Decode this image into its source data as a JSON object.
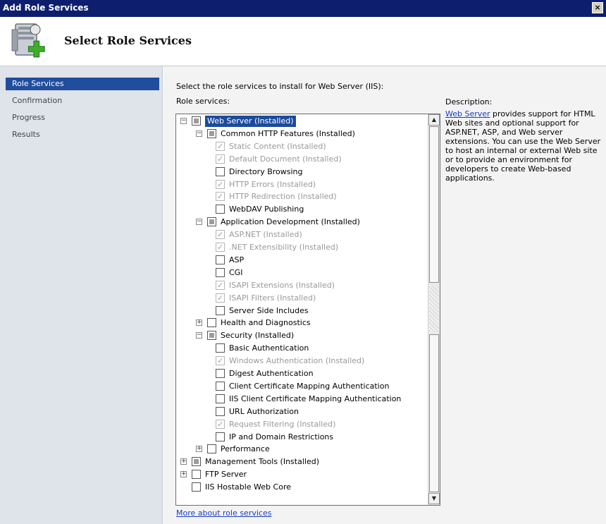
{
  "window": {
    "title": "Add Role Services",
    "close_label": "×"
  },
  "header": {
    "title": "Select Role Services",
    "icon": "server-add-icon"
  },
  "nav": {
    "items": [
      {
        "label": "Role Services",
        "active": true
      },
      {
        "label": "Confirmation",
        "active": false
      },
      {
        "label": "Progress",
        "active": false
      },
      {
        "label": "Results",
        "active": false
      }
    ]
  },
  "main": {
    "intro": "Select the role services to install for Web Server (IIS):",
    "role_services_label": "Role services:",
    "more_link": "More about role services"
  },
  "description": {
    "title": "Description:",
    "link": "Web Server",
    "text": " provides support for HTML Web sites and optional support for ASP.NET, ASP, and Web server extensions. You can use the Web Server to host an internal or external Web site or to provide an environment for developers to create Web-based applications."
  },
  "tree": [
    {
      "label": "Web Server  (Installed)",
      "level": 0,
      "expander": "minus",
      "check": "mixed",
      "disabled": false,
      "selected": true
    },
    {
      "label": "Common HTTP Features  (Installed)",
      "level": 1,
      "expander": "minus",
      "check": "mixed",
      "disabled": false
    },
    {
      "label": "Static Content  (Installed)",
      "level": 2,
      "check": "checked",
      "disabled": true
    },
    {
      "label": "Default Document  (Installed)",
      "level": 2,
      "check": "checked",
      "disabled": true
    },
    {
      "label": "Directory Browsing",
      "level": 2,
      "check": "unchecked",
      "disabled": false
    },
    {
      "label": "HTTP Errors  (Installed)",
      "level": 2,
      "check": "checked",
      "disabled": true
    },
    {
      "label": "HTTP Redirection  (Installed)",
      "level": 2,
      "check": "checked",
      "disabled": true
    },
    {
      "label": "WebDAV Publishing",
      "level": 2,
      "check": "unchecked",
      "disabled": false
    },
    {
      "label": "Application Development  (Installed)",
      "level": 1,
      "expander": "minus",
      "check": "mixed",
      "disabled": false
    },
    {
      "label": "ASP.NET  (Installed)",
      "level": 2,
      "check": "checked",
      "disabled": true
    },
    {
      "label": ".NET Extensibility  (Installed)",
      "level": 2,
      "check": "checked",
      "disabled": true
    },
    {
      "label": "ASP",
      "level": 2,
      "check": "unchecked",
      "disabled": false
    },
    {
      "label": "CGI",
      "level": 2,
      "check": "unchecked",
      "disabled": false
    },
    {
      "label": "ISAPI Extensions  (Installed)",
      "level": 2,
      "check": "checked",
      "disabled": true
    },
    {
      "label": "ISAPI Filters  (Installed)",
      "level": 2,
      "check": "checked",
      "disabled": true
    },
    {
      "label": "Server Side Includes",
      "level": 2,
      "check": "unchecked",
      "disabled": false
    },
    {
      "label": "Health and Diagnostics",
      "level": 1,
      "expander": "plus",
      "check": "unchecked",
      "disabled": false
    },
    {
      "label": "Security  (Installed)",
      "level": 1,
      "expander": "minus",
      "check": "mixed",
      "disabled": false
    },
    {
      "label": "Basic Authentication",
      "level": 2,
      "check": "unchecked",
      "disabled": false
    },
    {
      "label": "Windows Authentication  (Installed)",
      "level": 2,
      "check": "checked",
      "disabled": true
    },
    {
      "label": "Digest Authentication",
      "level": 2,
      "check": "unchecked",
      "disabled": false
    },
    {
      "label": "Client Certificate Mapping Authentication",
      "level": 2,
      "check": "unchecked",
      "disabled": false
    },
    {
      "label": "IIS Client Certificate Mapping Authentication",
      "level": 2,
      "check": "unchecked",
      "disabled": false
    },
    {
      "label": "URL Authorization",
      "level": 2,
      "check": "unchecked",
      "disabled": false
    },
    {
      "label": "Request Filtering  (Installed)",
      "level": 2,
      "check": "checked",
      "disabled": true
    },
    {
      "label": "IP and Domain Restrictions",
      "level": 2,
      "check": "unchecked",
      "disabled": false
    },
    {
      "label": "Performance",
      "level": 1,
      "expander": "plus",
      "check": "unchecked",
      "disabled": false
    },
    {
      "label": "Management Tools  (Installed)",
      "level": 0,
      "expander": "plus",
      "check": "mixed",
      "disabled": false
    },
    {
      "label": "FTP Server",
      "level": 0,
      "expander": "plus",
      "check": "unchecked",
      "disabled": false
    },
    {
      "label": "IIS Hostable Web Core",
      "level": 0,
      "check": "unchecked",
      "disabled": false
    }
  ],
  "scrollbar": {
    "up_icon": "scroll-up-icon",
    "down_icon": "scroll-down-icon"
  }
}
